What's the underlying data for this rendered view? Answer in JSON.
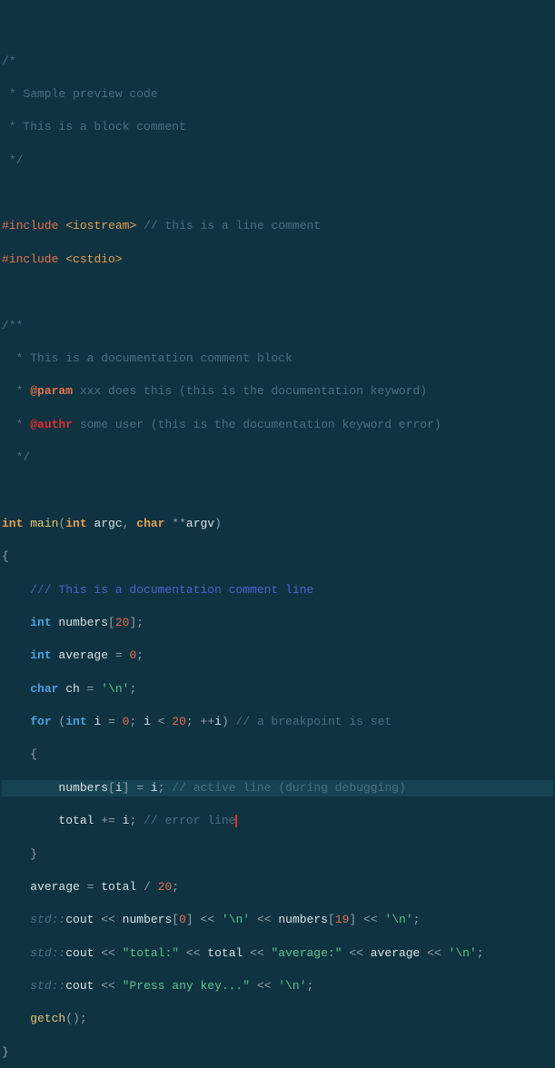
{
  "code": {
    "block_comment": {
      "l1": "/*",
      "l2": " * Sample preview code",
      "l3": " * This is a block comment",
      "l4": " */"
    },
    "include1": {
      "directive": "#include",
      "header": "<iostream>",
      "comment": "// this is a line comment"
    },
    "include2": {
      "directive": "#include",
      "header": "<cstdio>"
    },
    "doc_block": {
      "l1": "/**",
      "l2_pre": "  * ",
      "l2_text": "This is a documentation comment block",
      "l3_pre": "  * ",
      "l3_tag": "@param",
      "l3_text": " xxx does this (this is the documentation keyword)",
      "l4_pre": "  * ",
      "l4_tag": "@authr",
      "l4_text": " some user (this is the documentation keyword error)",
      "l5": "  */"
    },
    "main_sig": {
      "int": "int",
      "name": "main",
      "lp": "(",
      "p1_type": "int",
      "p1_name": " argc",
      "comma": ", ",
      "p2_type": "char",
      "p2_ptr": " **",
      "p2_name": "argv",
      "rp": ")"
    },
    "brace_open": "{",
    "doc_line": "/// This is a documentation comment line",
    "decl1": {
      "type": "int",
      "name": " numbers",
      "lb": "[",
      "size": "20",
      "rb": "];"
    },
    "decl2": {
      "type": "int",
      "name": " average ",
      "eq": "=",
      "sp": " ",
      "val": "0",
      "semi": ";"
    },
    "decl3": {
      "type": "char",
      "name": " ch ",
      "eq": "=",
      "sp": " ",
      "val": "'\\n'",
      "semi": ";"
    },
    "for": {
      "kw": "for",
      "lp": " (",
      "type": "int",
      "var": " i ",
      "eq": "=",
      "init": " 0",
      "semi1": "; ",
      "cond_l": "i ",
      "lt": "<",
      "cond_r": " 20",
      "semi2": "; ",
      "inc": "++",
      "inc_var": "i",
      "rp": ")",
      "comment": " // a breakpoint is set"
    },
    "for_open": "    {",
    "active": {
      "indent": "        ",
      "arr": "numbers",
      "lb": "[",
      "idx": "i",
      "rb": "] ",
      "eq": "=",
      "rhs": " i",
      "semi": ";",
      "comment": " // active line (during debugging)"
    },
    "error": {
      "indent": "        ",
      "lhs": "total ",
      "op": "+=",
      "rhs": " i",
      "semi": ";",
      "comment": " // error line"
    },
    "for_close": "    }",
    "avg": {
      "lhs": "average ",
      "eq": "=",
      "mid": " total ",
      "div": "/",
      "sp": " ",
      "val": "20",
      "semi": ";"
    },
    "cout1": {
      "ns": "std::",
      "obj": "cout",
      "op1": " <<",
      "arr": " numbers",
      "lb": "[",
      "idx0": "0",
      "rb": "]",
      "op2": " <<",
      "nl1": " '\\n'",
      "op3": " <<",
      "arr2": " numbers",
      "lb2": "[",
      "idx19": "19",
      "rb2": "]",
      "op4": " <<",
      "nl2": " '\\n'",
      "semi": ";"
    },
    "cout2": {
      "ns": "std::",
      "obj": "cout",
      "op1": " <<",
      "str1": " \"total:\"",
      "op2": " <<",
      "v1": " total",
      "op3": " <<",
      "str2": " \"average:\"",
      "op4": " <<",
      "v2": " average",
      "op5": " <<",
      "nl": " '\\n'",
      "semi": ";"
    },
    "cout3": {
      "ns": "std::",
      "obj": "cout",
      "op1": " <<",
      "str": " \"Press any key...\"",
      "op2": " <<",
      "nl": " '\\n'",
      "semi": ";"
    },
    "getch": {
      "fn": "getch",
      "call": "();"
    },
    "brace_close": "}"
  }
}
